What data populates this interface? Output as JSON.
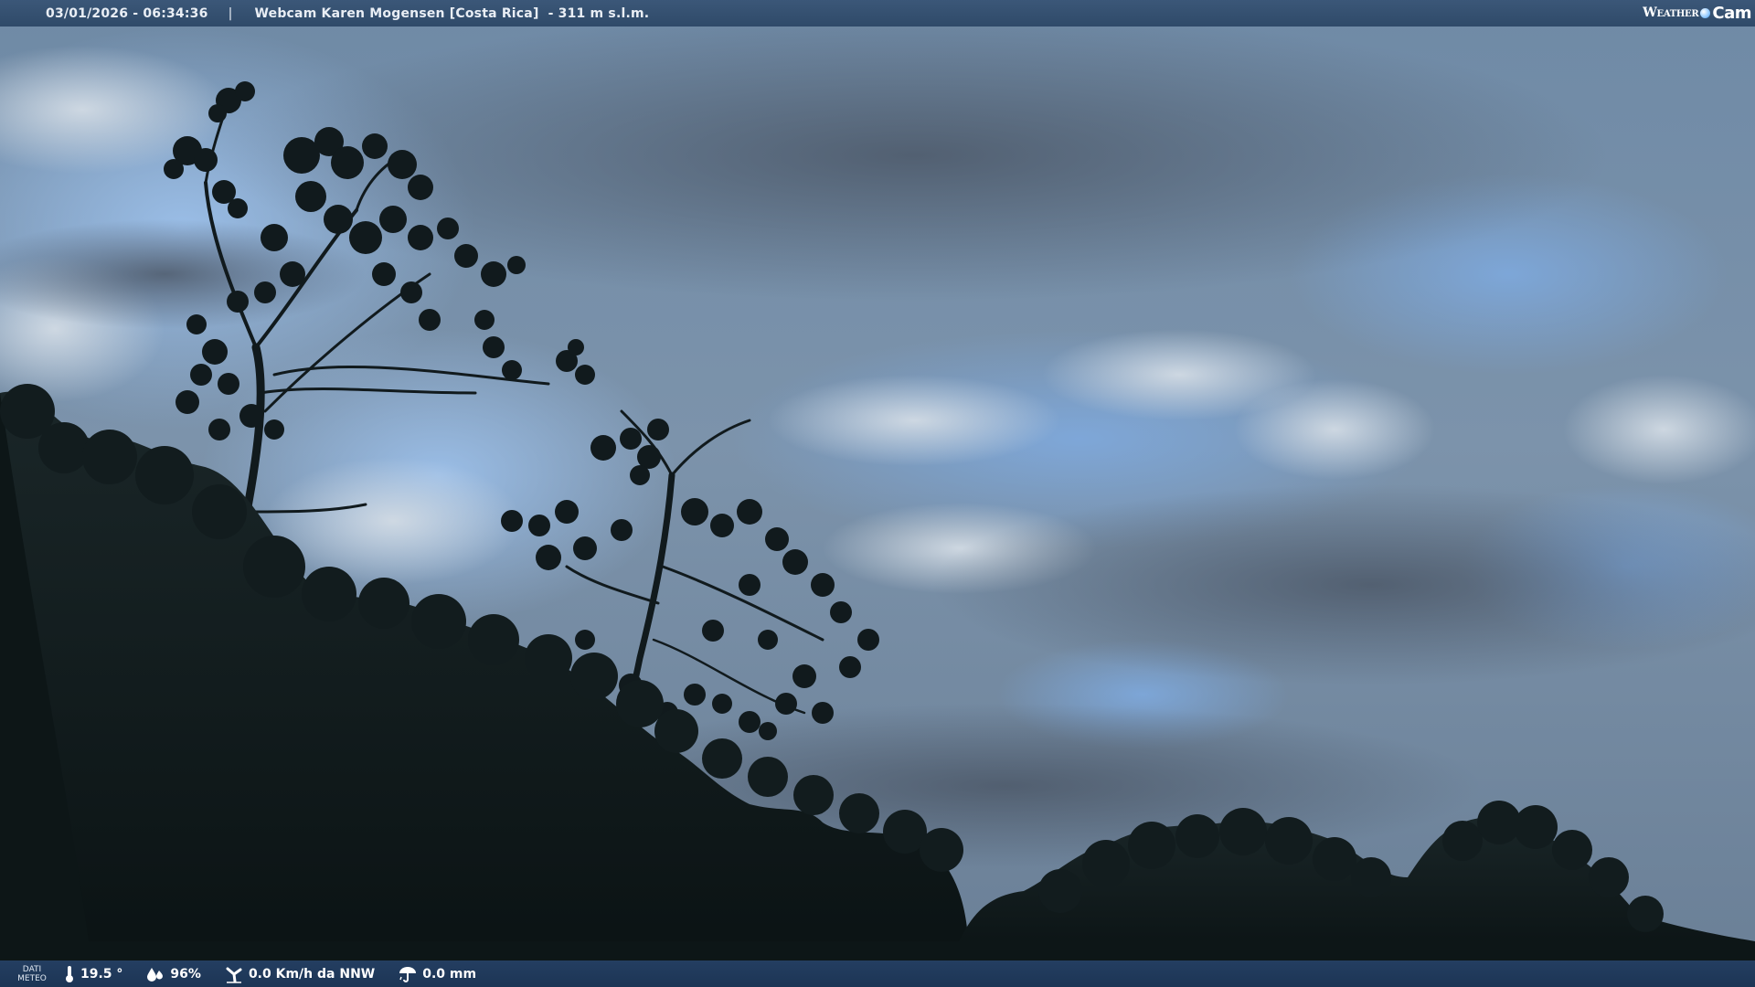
{
  "header": {
    "timestamp": "03/01/2026 - 06:34:36",
    "separator": "|",
    "camera_name": "Webcam Karen Mogensen [Costa Rica]",
    "altitude": "- 311 m s.l.m."
  },
  "logo": {
    "part1": "Weather",
    "part2": "Cam"
  },
  "footer": {
    "label_line1": "DATI",
    "label_line2": "METEO",
    "temperature": "19.5 °",
    "humidity": "96%",
    "wind": "0.0 Km/h da NNW",
    "rain": "0.0 mm"
  },
  "colors": {
    "sky_blue": "#7fa6d6",
    "cloud_grey": "#6b7a8c",
    "vegetation": "#0f1a1b",
    "bar_top": "#33506f",
    "bar_bottom": "#1f395a"
  },
  "icons": [
    "thermometer-icon",
    "humidity-drops-icon",
    "wind-icon",
    "rain-umbrella-icon",
    "weather-globe-icon"
  ]
}
